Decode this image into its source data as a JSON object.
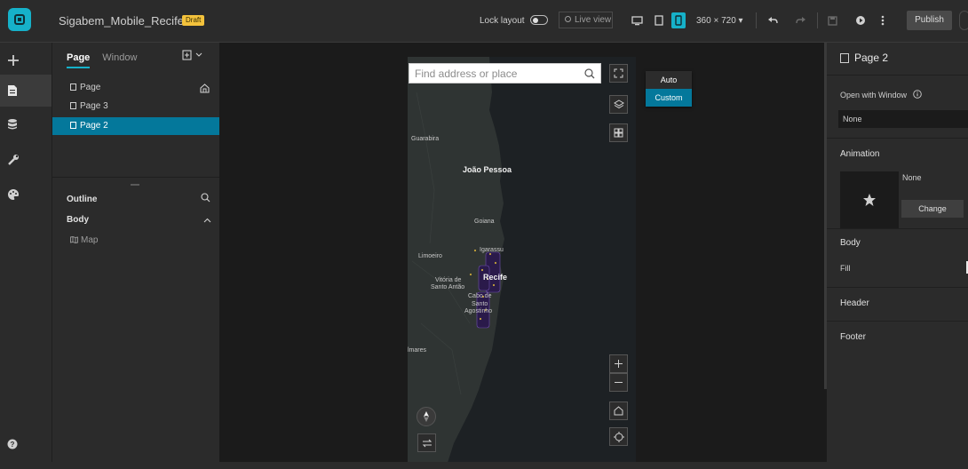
{
  "app": {
    "title": "Sigabem_Mobile_Recife",
    "status_badge": "Draft"
  },
  "toolbar": {
    "lock_layout_label": "Lock layout",
    "live_view_label": "Live view",
    "resolution": "360 × 720 ▾",
    "publish_label": "Publish",
    "accent_color": "#16b1c9"
  },
  "left_panel": {
    "tabs": [
      {
        "label": "Page"
      },
      {
        "label": "Window"
      }
    ],
    "pages": [
      {
        "label": "Page"
      },
      {
        "label": "Page 3"
      },
      {
        "label": "Page 2"
      }
    ],
    "outline_label": "Outline",
    "body_label": "Body",
    "map_item": "Map"
  },
  "map": {
    "search_placeholder": "Find address or place",
    "view_mode_options": [
      {
        "label": "Auto"
      },
      {
        "label": "Custom"
      }
    ],
    "selected_color": "#04789b",
    "places": [
      "Guarabira",
      "João Pessoa",
      "Goiana",
      "Limoeiro",
      "Igarassu",
      "Vitória de",
      "Santo Antão",
      "Recife",
      "Cabo de",
      "Santo",
      "Agostinho",
      "lmares"
    ]
  },
  "right_panel": {
    "title": "Page 2",
    "open_with_window_label": "Open with Window",
    "open_with_window_value": "None",
    "animation_label": "Animation",
    "animation_value": "None",
    "change_label": "Change",
    "body_label": "Body",
    "fill_label": "Fill",
    "header_label": "Header",
    "footer_label": "Footer"
  }
}
